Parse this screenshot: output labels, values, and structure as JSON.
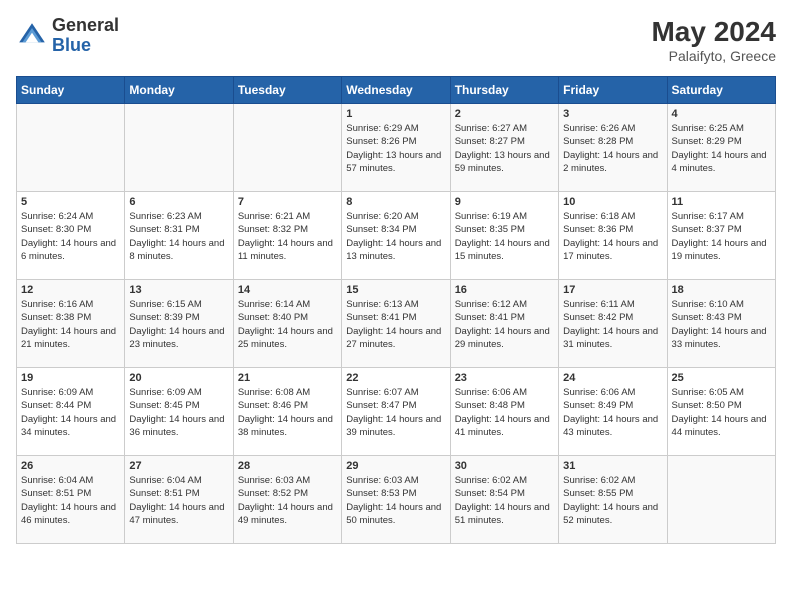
{
  "header": {
    "logo": "GeneralBlue",
    "month_year": "May 2024",
    "location": "Palaifyto, Greece"
  },
  "days_of_week": [
    "Sunday",
    "Monday",
    "Tuesday",
    "Wednesday",
    "Thursday",
    "Friday",
    "Saturday"
  ],
  "weeks": [
    [
      {
        "day": "",
        "sunrise": "",
        "sunset": "",
        "daylight": ""
      },
      {
        "day": "",
        "sunrise": "",
        "sunset": "",
        "daylight": ""
      },
      {
        "day": "",
        "sunrise": "",
        "sunset": "",
        "daylight": ""
      },
      {
        "day": "1",
        "sunrise": "Sunrise: 6:29 AM",
        "sunset": "Sunset: 8:26 PM",
        "daylight": "Daylight: 13 hours and 57 minutes."
      },
      {
        "day": "2",
        "sunrise": "Sunrise: 6:27 AM",
        "sunset": "Sunset: 8:27 PM",
        "daylight": "Daylight: 13 hours and 59 minutes."
      },
      {
        "day": "3",
        "sunrise": "Sunrise: 6:26 AM",
        "sunset": "Sunset: 8:28 PM",
        "daylight": "Daylight: 14 hours and 2 minutes."
      },
      {
        "day": "4",
        "sunrise": "Sunrise: 6:25 AM",
        "sunset": "Sunset: 8:29 PM",
        "daylight": "Daylight: 14 hours and 4 minutes."
      }
    ],
    [
      {
        "day": "5",
        "sunrise": "Sunrise: 6:24 AM",
        "sunset": "Sunset: 8:30 PM",
        "daylight": "Daylight: 14 hours and 6 minutes."
      },
      {
        "day": "6",
        "sunrise": "Sunrise: 6:23 AM",
        "sunset": "Sunset: 8:31 PM",
        "daylight": "Daylight: 14 hours and 8 minutes."
      },
      {
        "day": "7",
        "sunrise": "Sunrise: 6:21 AM",
        "sunset": "Sunset: 8:32 PM",
        "daylight": "Daylight: 14 hours and 11 minutes."
      },
      {
        "day": "8",
        "sunrise": "Sunrise: 6:20 AM",
        "sunset": "Sunset: 8:34 PM",
        "daylight": "Daylight: 14 hours and 13 minutes."
      },
      {
        "day": "9",
        "sunrise": "Sunrise: 6:19 AM",
        "sunset": "Sunset: 8:35 PM",
        "daylight": "Daylight: 14 hours and 15 minutes."
      },
      {
        "day": "10",
        "sunrise": "Sunrise: 6:18 AM",
        "sunset": "Sunset: 8:36 PM",
        "daylight": "Daylight: 14 hours and 17 minutes."
      },
      {
        "day": "11",
        "sunrise": "Sunrise: 6:17 AM",
        "sunset": "Sunset: 8:37 PM",
        "daylight": "Daylight: 14 hours and 19 minutes."
      }
    ],
    [
      {
        "day": "12",
        "sunrise": "Sunrise: 6:16 AM",
        "sunset": "Sunset: 8:38 PM",
        "daylight": "Daylight: 14 hours and 21 minutes."
      },
      {
        "day": "13",
        "sunrise": "Sunrise: 6:15 AM",
        "sunset": "Sunset: 8:39 PM",
        "daylight": "Daylight: 14 hours and 23 minutes."
      },
      {
        "day": "14",
        "sunrise": "Sunrise: 6:14 AM",
        "sunset": "Sunset: 8:40 PM",
        "daylight": "Daylight: 14 hours and 25 minutes."
      },
      {
        "day": "15",
        "sunrise": "Sunrise: 6:13 AM",
        "sunset": "Sunset: 8:41 PM",
        "daylight": "Daylight: 14 hours and 27 minutes."
      },
      {
        "day": "16",
        "sunrise": "Sunrise: 6:12 AM",
        "sunset": "Sunset: 8:41 PM",
        "daylight": "Daylight: 14 hours and 29 minutes."
      },
      {
        "day": "17",
        "sunrise": "Sunrise: 6:11 AM",
        "sunset": "Sunset: 8:42 PM",
        "daylight": "Daylight: 14 hours and 31 minutes."
      },
      {
        "day": "18",
        "sunrise": "Sunrise: 6:10 AM",
        "sunset": "Sunset: 8:43 PM",
        "daylight": "Daylight: 14 hours and 33 minutes."
      }
    ],
    [
      {
        "day": "19",
        "sunrise": "Sunrise: 6:09 AM",
        "sunset": "Sunset: 8:44 PM",
        "daylight": "Daylight: 14 hours and 34 minutes."
      },
      {
        "day": "20",
        "sunrise": "Sunrise: 6:09 AM",
        "sunset": "Sunset: 8:45 PM",
        "daylight": "Daylight: 14 hours and 36 minutes."
      },
      {
        "day": "21",
        "sunrise": "Sunrise: 6:08 AM",
        "sunset": "Sunset: 8:46 PM",
        "daylight": "Daylight: 14 hours and 38 minutes."
      },
      {
        "day": "22",
        "sunrise": "Sunrise: 6:07 AM",
        "sunset": "Sunset: 8:47 PM",
        "daylight": "Daylight: 14 hours and 39 minutes."
      },
      {
        "day": "23",
        "sunrise": "Sunrise: 6:06 AM",
        "sunset": "Sunset: 8:48 PM",
        "daylight": "Daylight: 14 hours and 41 minutes."
      },
      {
        "day": "24",
        "sunrise": "Sunrise: 6:06 AM",
        "sunset": "Sunset: 8:49 PM",
        "daylight": "Daylight: 14 hours and 43 minutes."
      },
      {
        "day": "25",
        "sunrise": "Sunrise: 6:05 AM",
        "sunset": "Sunset: 8:50 PM",
        "daylight": "Daylight: 14 hours and 44 minutes."
      }
    ],
    [
      {
        "day": "26",
        "sunrise": "Sunrise: 6:04 AM",
        "sunset": "Sunset: 8:51 PM",
        "daylight": "Daylight: 14 hours and 46 minutes."
      },
      {
        "day": "27",
        "sunrise": "Sunrise: 6:04 AM",
        "sunset": "Sunset: 8:51 PM",
        "daylight": "Daylight: 14 hours and 47 minutes."
      },
      {
        "day": "28",
        "sunrise": "Sunrise: 6:03 AM",
        "sunset": "Sunset: 8:52 PM",
        "daylight": "Daylight: 14 hours and 49 minutes."
      },
      {
        "day": "29",
        "sunrise": "Sunrise: 6:03 AM",
        "sunset": "Sunset: 8:53 PM",
        "daylight": "Daylight: 14 hours and 50 minutes."
      },
      {
        "day": "30",
        "sunrise": "Sunrise: 6:02 AM",
        "sunset": "Sunset: 8:54 PM",
        "daylight": "Daylight: 14 hours and 51 minutes."
      },
      {
        "day": "31",
        "sunrise": "Sunrise: 6:02 AM",
        "sunset": "Sunset: 8:55 PM",
        "daylight": "Daylight: 14 hours and 52 minutes."
      },
      {
        "day": "",
        "sunrise": "",
        "sunset": "",
        "daylight": ""
      }
    ]
  ]
}
